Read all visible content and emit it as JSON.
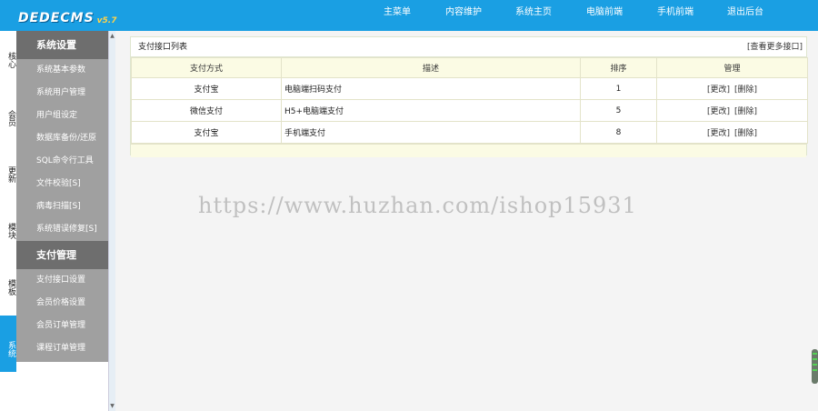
{
  "logo": {
    "text": "DEDECMS",
    "version": "v5.7"
  },
  "nav": [
    {
      "label": "主菜单"
    },
    {
      "label": "内容维护"
    },
    {
      "label": "系统主页"
    },
    {
      "label": "电脑前端"
    },
    {
      "label": "手机前端"
    },
    {
      "label": "退出后台"
    }
  ],
  "tabs": [
    {
      "label": "核心"
    },
    {
      "label": "会员"
    },
    {
      "label": "更新"
    },
    {
      "label": "模块"
    },
    {
      "label": "模板"
    },
    {
      "label": "系统"
    }
  ],
  "sidebar": {
    "group1": {
      "title": "系统设置",
      "items": [
        "系统基本参数",
        "系统用户管理",
        "用户组设定",
        "数据库备份/还原",
        "SQL命令行工具",
        "文件校验[S]",
        "病毒扫描[S]",
        "系统错误修复[S]"
      ]
    },
    "group2": {
      "title": "支付管理",
      "items": [
        "支付接口设置",
        "会员价格设置",
        "会员订单管理",
        "课程订单管理"
      ]
    }
  },
  "panel": {
    "title": "支付接口列表",
    "more_link": "[查看更多接口]",
    "columns": [
      "支付方式",
      "描述",
      "排序",
      "管理"
    ],
    "rows": [
      {
        "method": "支付宝",
        "desc": "电脑端扫码支付",
        "order": "1",
        "edit": "[更改]",
        "del": "[删除]"
      },
      {
        "method": "微信支付",
        "desc": "H5+电脑端支付",
        "order": "5",
        "edit": "[更改]",
        "del": "[删除]"
      },
      {
        "method": "支付宝",
        "desc": "手机端支付",
        "order": "8",
        "edit": "[更改]",
        "del": "[删除]"
      }
    ]
  },
  "watermark": "https://www.huzhan.com/ishop15931",
  "colors": {
    "topbar": "#1a9fe3",
    "sidebar": "#a0a0a0",
    "sidebar_head": "#6e6e6e",
    "table_head": "#fbfbe4"
  }
}
